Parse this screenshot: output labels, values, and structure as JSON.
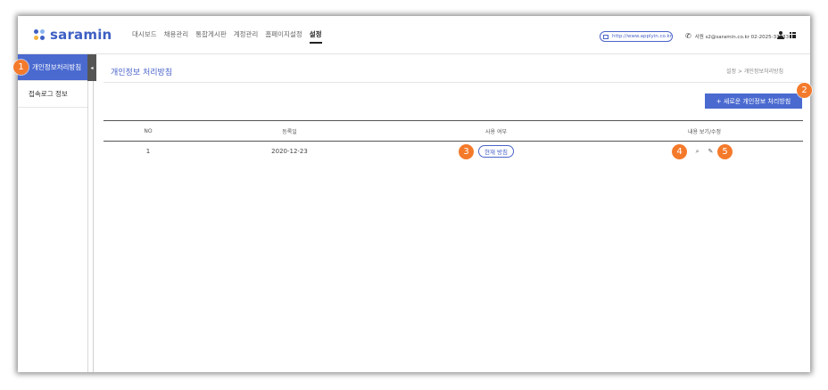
{
  "brand": {
    "name": "saramin",
    "dot_colors": [
      "#3d5fc4",
      "#8ab4f0",
      "#f3b33d",
      "#3d5fc4"
    ]
  },
  "nav": {
    "items": [
      "대시보드",
      "채용관리",
      "통합게시판",
      "계정관리",
      "홈페이지설정",
      "설정"
    ],
    "active": "설정"
  },
  "header": {
    "url": "http://www.applyin.co.kr",
    "contact": "사원 s2@saramin.co.kr 02-2025-33333"
  },
  "sidebar": {
    "items": [
      {
        "label": "개인정보처리방침",
        "active": true
      },
      {
        "label": "접속로그 정보",
        "active": false
      }
    ]
  },
  "page": {
    "title": "개인정보 처리방침",
    "breadcrumb": "설정  >  개인정보처리방침",
    "new_button": "+ 새로운 개인정보 처리방침"
  },
  "table": {
    "headers": [
      "NO",
      "등록일",
      "사용 여부",
      "내용 보기/수정"
    ],
    "rows": [
      {
        "no": "1",
        "date": "2020-12-23",
        "status": "현재 방침"
      }
    ]
  },
  "markers": [
    "1",
    "2",
    "3",
    "4",
    "5"
  ],
  "colors": {
    "accent": "#4a6ad0",
    "marker": "#f47a2b"
  }
}
